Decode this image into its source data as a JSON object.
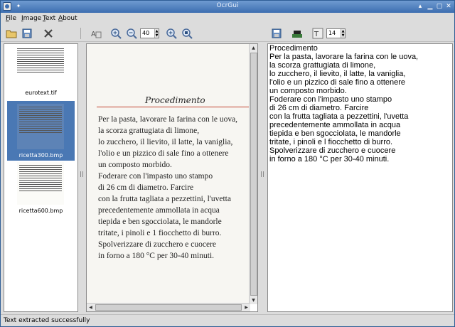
{
  "window": {
    "title": "OcrGui"
  },
  "menu": {
    "items": [
      "File",
      "Image",
      "Text",
      "About"
    ]
  },
  "toolbar": {
    "zoom_value": "40",
    "font_size_value": "14"
  },
  "thumbnails": [
    {
      "caption": "eurotext.tif"
    },
    {
      "caption": "ricetta300.bmp"
    },
    {
      "caption": "ricetta600.bmp"
    }
  ],
  "image_page": {
    "title": "Procedimento",
    "lines": [
      "Per la pasta, lavorare la farina con le uova,",
      "la scorza grattugiata di limone,",
      "lo zucchero, il lievito, il latte, la vaniglia,",
      "l'olio e un pizzico di sale fino a ottenere",
      "un composto morbido.",
      "Foderare con l'impasto uno stampo",
      "di 26 cm di diametro. Farcire",
      "con la frutta tagliata a pezzettini, l'uvetta",
      "precedentemente ammollata in acqua",
      "tiepida e ben sgocciolata, le mandorle",
      "tritate, i pinoli e 1 fiocchetto di burro.",
      "Spolverizzare di zucchero e cuocere",
      "in forno a 180 °C per 30-40 minuti."
    ]
  },
  "extracted_text": {
    "lines": [
      "Procedimento",
      "Per la pasta, lavorare la farina con le uova,",
      "la scorza grattugiata di limone,",
      "lo zucchero, il lievito, il latte, la vaniglia,",
      "l'olio e un pizzico di sale fino a ottenere",
      "un composto morbido.",
      "Foderare con l'impasto uno stampo",
      "di 26 cm di diametro. Farcire",
      "con la frutta tagliata a pezzettini, l'uvetta",
      "precedentemente ammollata in acqua",
      "tiepida e ben sgocciolata, le mandorle",
      "tritate, i pinoli e l fiocchetto di burro.",
      "Spolverizzare di zucchero e cuocere",
      "in forno a 180 °C per 30-40 minuti."
    ]
  },
  "status": {
    "text": "Text extracted successfully"
  },
  "colors": {
    "titlebar": "#3d6eb0",
    "selection": "#4a78b4",
    "page_rule": "#c0412f"
  }
}
